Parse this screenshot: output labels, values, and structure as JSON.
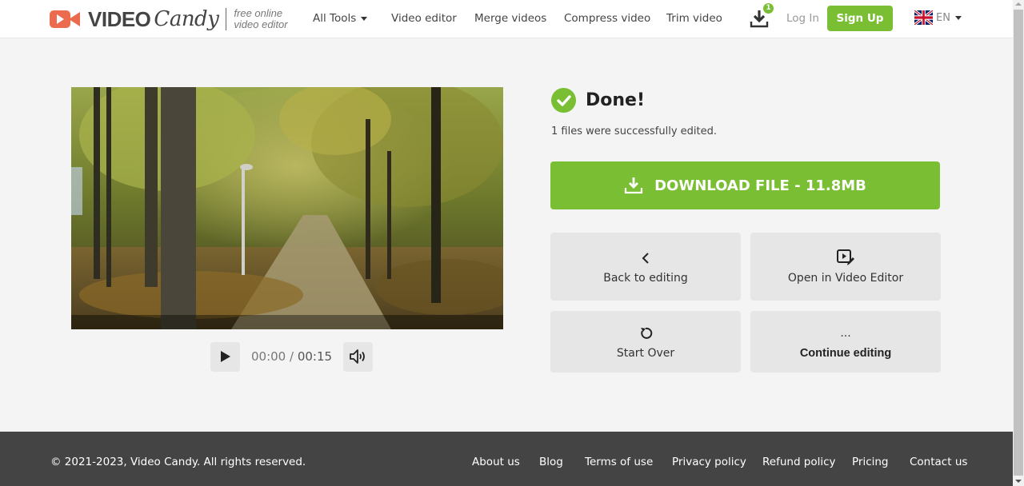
{
  "header": {
    "logo": {
      "brand_bold": "VIDEO",
      "brand_script": "Candy",
      "tagline_line1": "free online",
      "tagline_line2": "video editor"
    },
    "nav": [
      {
        "label": "All Tools",
        "has_dropdown": true
      },
      {
        "label": "Video editor"
      },
      {
        "label": "Merge videos"
      },
      {
        "label": "Compress video"
      },
      {
        "label": "Trim video"
      }
    ],
    "downloads_icon": "download-tray-icon",
    "downloads_badge": "1",
    "login_label": "Log In",
    "signup_label": "Sign Up",
    "language": {
      "flag": "uk-flag-icon",
      "code": "EN"
    }
  },
  "player": {
    "thumbnail_description": "Autumn park path lined with trees",
    "current_time": "00:00",
    "separator": " / ",
    "duration": "00:15",
    "play_icon": "play-icon",
    "volume_icon": "volume-icon"
  },
  "result": {
    "status_icon": "check-circle-icon",
    "title": "Done!",
    "subtitle": "1 files were successfully edited.",
    "download_label": "DOWNLOAD FILE - 11.8MB",
    "actions": [
      {
        "label": "Back to editing",
        "icon": "chevron-left-icon"
      },
      {
        "label": "Open in Video Editor",
        "icon": "video-edit-icon"
      },
      {
        "label": "Start Over",
        "icon": "restart-icon"
      },
      {
        "label": "Continue editing",
        "icon": "more-icon",
        "icon_text": "..."
      }
    ]
  },
  "footer": {
    "copyright": "© 2021-2023, Video Candy. All rights reserved.",
    "links": [
      "About us",
      "Blog",
      "Terms of use",
      "Privacy policy",
      "Refund policy",
      "Pricing",
      "Contact us"
    ]
  },
  "colors": {
    "brand_green": "#7abf33",
    "logo_orange": "#ec6b4f",
    "footer_bg": "#444444",
    "page_bg": "#f4f4f4",
    "tile_bg": "#e6e6e6"
  }
}
